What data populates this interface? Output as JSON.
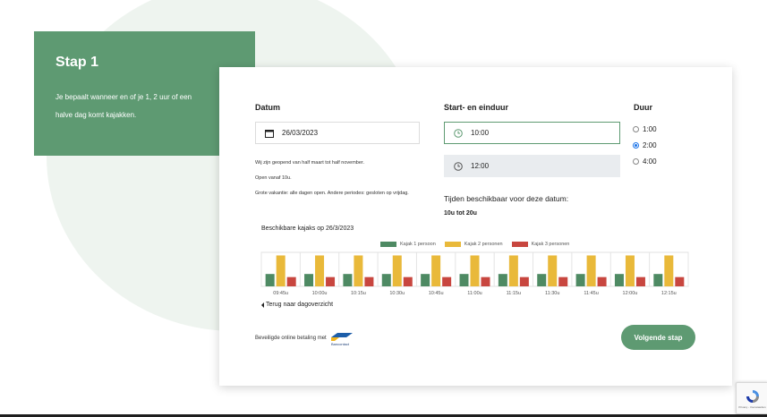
{
  "colors": {
    "brand_green": "#5e9a72",
    "kajak1": "#4e8a63",
    "kajak2": "#e9b93a",
    "kajak3": "#c8463f",
    "radio_blue": "#1a73e8"
  },
  "step": {
    "title": "Stap 1",
    "text": "Je bepaalt wanneer en of je 1, 2 uur of een halve dag komt kajakken."
  },
  "date": {
    "label": "Datum",
    "value": "26/03/2023",
    "icon": "calendar-icon",
    "info": [
      "Wij zijn geopend van half maart tot half november.",
      "Open vanaf 10u.",
      "Grote vakantie: alle dagen open. Andere periodes: gesloten op vrijdag."
    ]
  },
  "time": {
    "label": "Start- en einduur",
    "start": "10:00",
    "end": "12:00",
    "icon": "clock-icon",
    "available_label": "Tijden beschikbaar voor deze datum:",
    "available_value": "10u tot 20u"
  },
  "duration": {
    "label": "Duur",
    "options": [
      "1:00",
      "2:00",
      "4:00"
    ],
    "selected": "2:00"
  },
  "chart_data": {
    "type": "bar",
    "title": "Beschikbare kajaks op 26/3/2023",
    "categories": [
      "09:45u",
      "10:00u",
      "10:15u",
      "10:30u",
      "10:45u",
      "11:00u",
      "11:15u",
      "11:30u",
      "11:45u",
      "12:00u",
      "12:15u"
    ],
    "series": [
      {
        "name": "Kajak 1 persoon",
        "values": [
          4,
          4,
          4,
          4,
          4,
          4,
          4,
          4,
          4,
          4,
          4
        ]
      },
      {
        "name": "Kajak 2 personen",
        "values": [
          10,
          10,
          10,
          10,
          10,
          10,
          10,
          10,
          10,
          10,
          10
        ]
      },
      {
        "name": "Kajak 3 personen",
        "values": [
          3,
          3,
          3,
          3,
          3,
          3,
          3,
          3,
          3,
          3,
          3
        ]
      }
    ],
    "ylim": [
      0,
      11
    ],
    "grid": true,
    "legend": "top-center"
  },
  "back_link": "Terug naar dagoverzicht",
  "payment": {
    "text": "Beveiligde online betaling met",
    "logo_text": "Bancontact"
  },
  "next_button": "Volgende stap",
  "recaptcha_text": "Privacy - Voorwaarden"
}
